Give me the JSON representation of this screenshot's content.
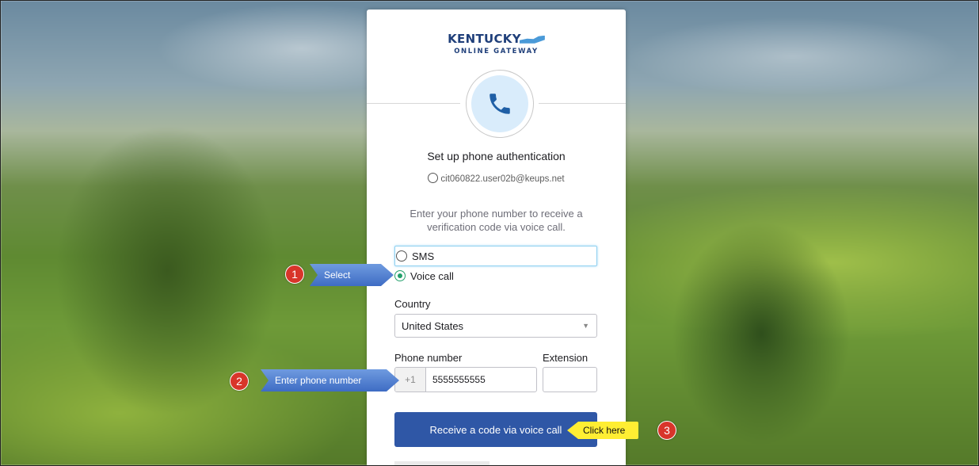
{
  "logo": {
    "title": "KENTUCKY",
    "subtitle": "ONLINE GATEWAY"
  },
  "heading": "Set up phone authentication",
  "user_email": "cit060822.user02b@keups.net",
  "description": "Enter your phone number to receive a verification code via voice call.",
  "method_options": [
    {
      "label": "SMS",
      "selected": false
    },
    {
      "label": "Voice call",
      "selected": true
    }
  ],
  "country": {
    "label": "Country",
    "value": "United States"
  },
  "phone": {
    "label": "Phone number",
    "prefix": "+1",
    "value": "5555555555"
  },
  "extension": {
    "label": "Extension",
    "value": ""
  },
  "submit_label": "Receive a code via voice call",
  "annotations": [
    {
      "number": "1",
      "text": "Select"
    },
    {
      "number": "2",
      "text": "Enter phone number"
    },
    {
      "number": "3",
      "text": "Click here"
    }
  ],
  "colors": {
    "primary_button": "#2f57a6",
    "radio_selected": "#22a06b",
    "logo": "#1f3f7a",
    "badge": "#d8352a",
    "hint_arrow": "#ffee33"
  },
  "icons": {
    "phone": "phone-icon",
    "user": "user-icon",
    "caret": "chevron-down-icon"
  }
}
